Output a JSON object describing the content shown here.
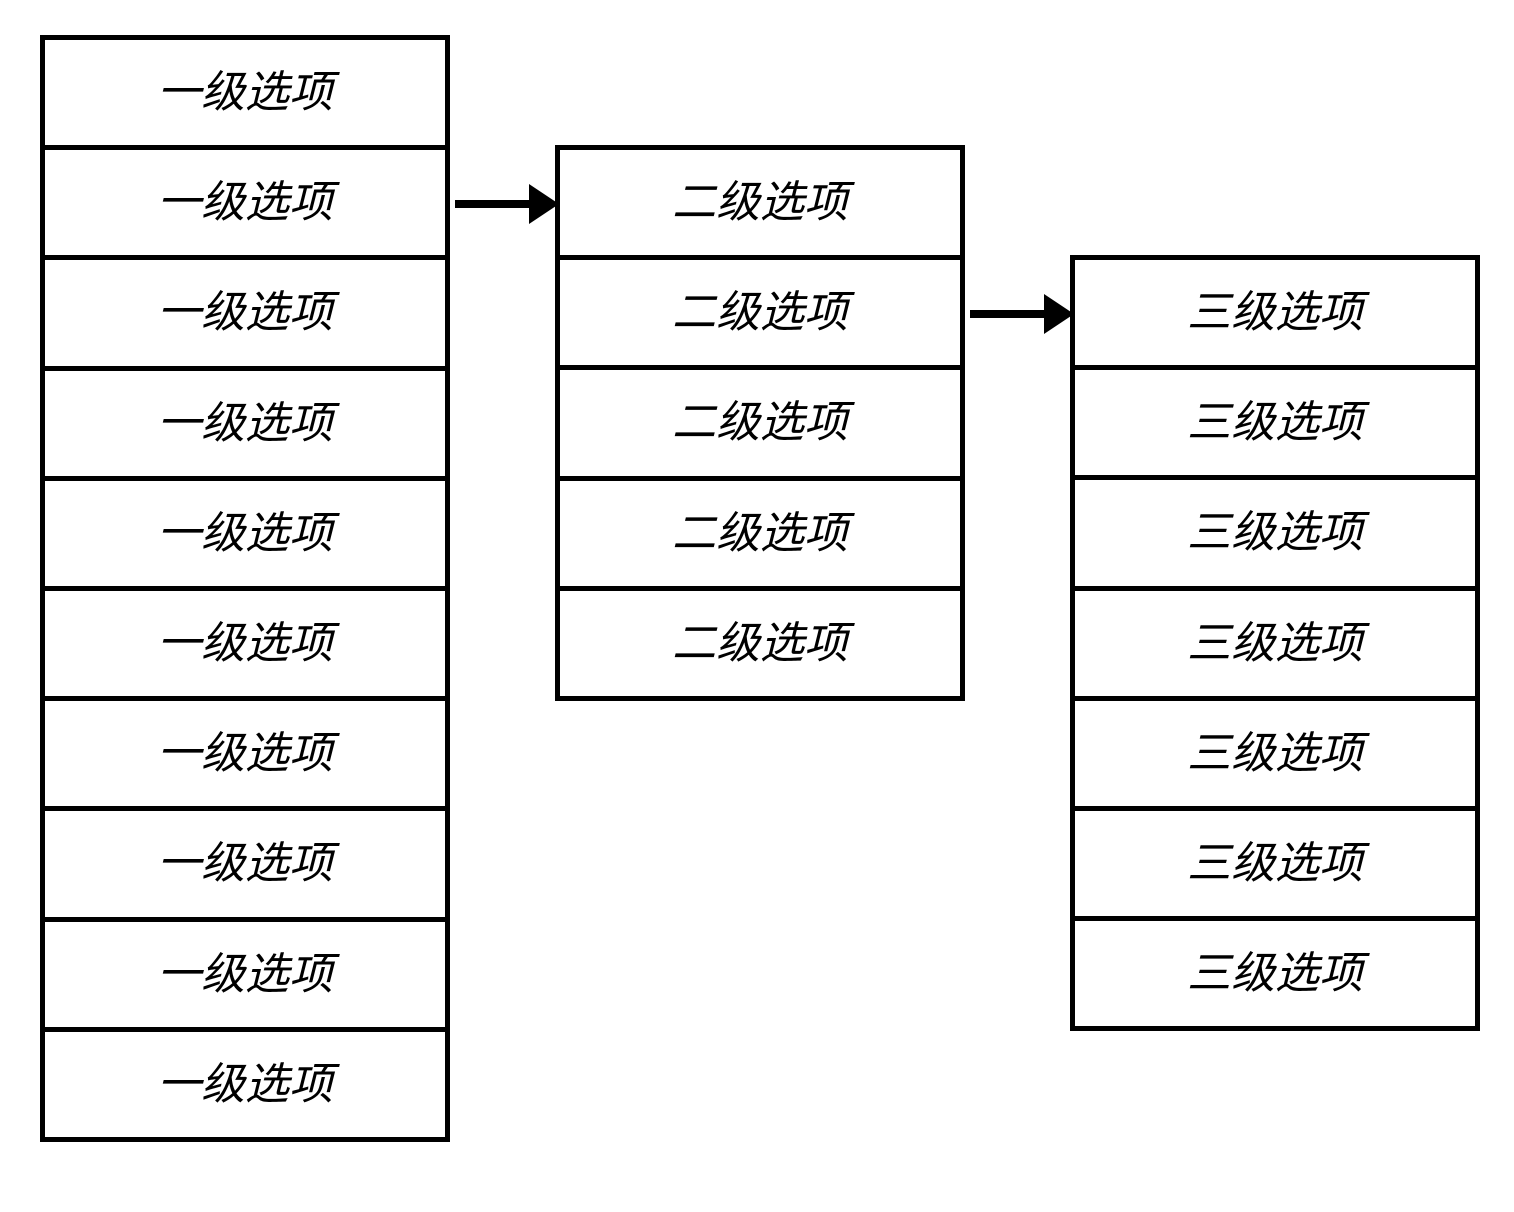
{
  "menus": {
    "level1": {
      "items": [
        {
          "label": "一级选项"
        },
        {
          "label": "一级选项"
        },
        {
          "label": "一级选项"
        },
        {
          "label": "一级选项"
        },
        {
          "label": "一级选项"
        },
        {
          "label": "一级选项"
        },
        {
          "label": "一级选项"
        },
        {
          "label": "一级选项"
        },
        {
          "label": "一级选项"
        },
        {
          "label": "一级选项"
        }
      ]
    },
    "level2": {
      "items": [
        {
          "label": "二级选项"
        },
        {
          "label": "二级选项"
        },
        {
          "label": "二级选项"
        },
        {
          "label": "二级选项"
        },
        {
          "label": "二级选项"
        }
      ]
    },
    "level3": {
      "items": [
        {
          "label": "三级选项"
        },
        {
          "label": "三级选项"
        },
        {
          "label": "三级选项"
        },
        {
          "label": "三级选项"
        },
        {
          "label": "三级选项"
        },
        {
          "label": "三级选项"
        },
        {
          "label": "三级选项"
        }
      ]
    }
  },
  "arrows": [
    {
      "from": "level1",
      "to": "level2"
    },
    {
      "from": "level2",
      "to": "level3"
    }
  ]
}
